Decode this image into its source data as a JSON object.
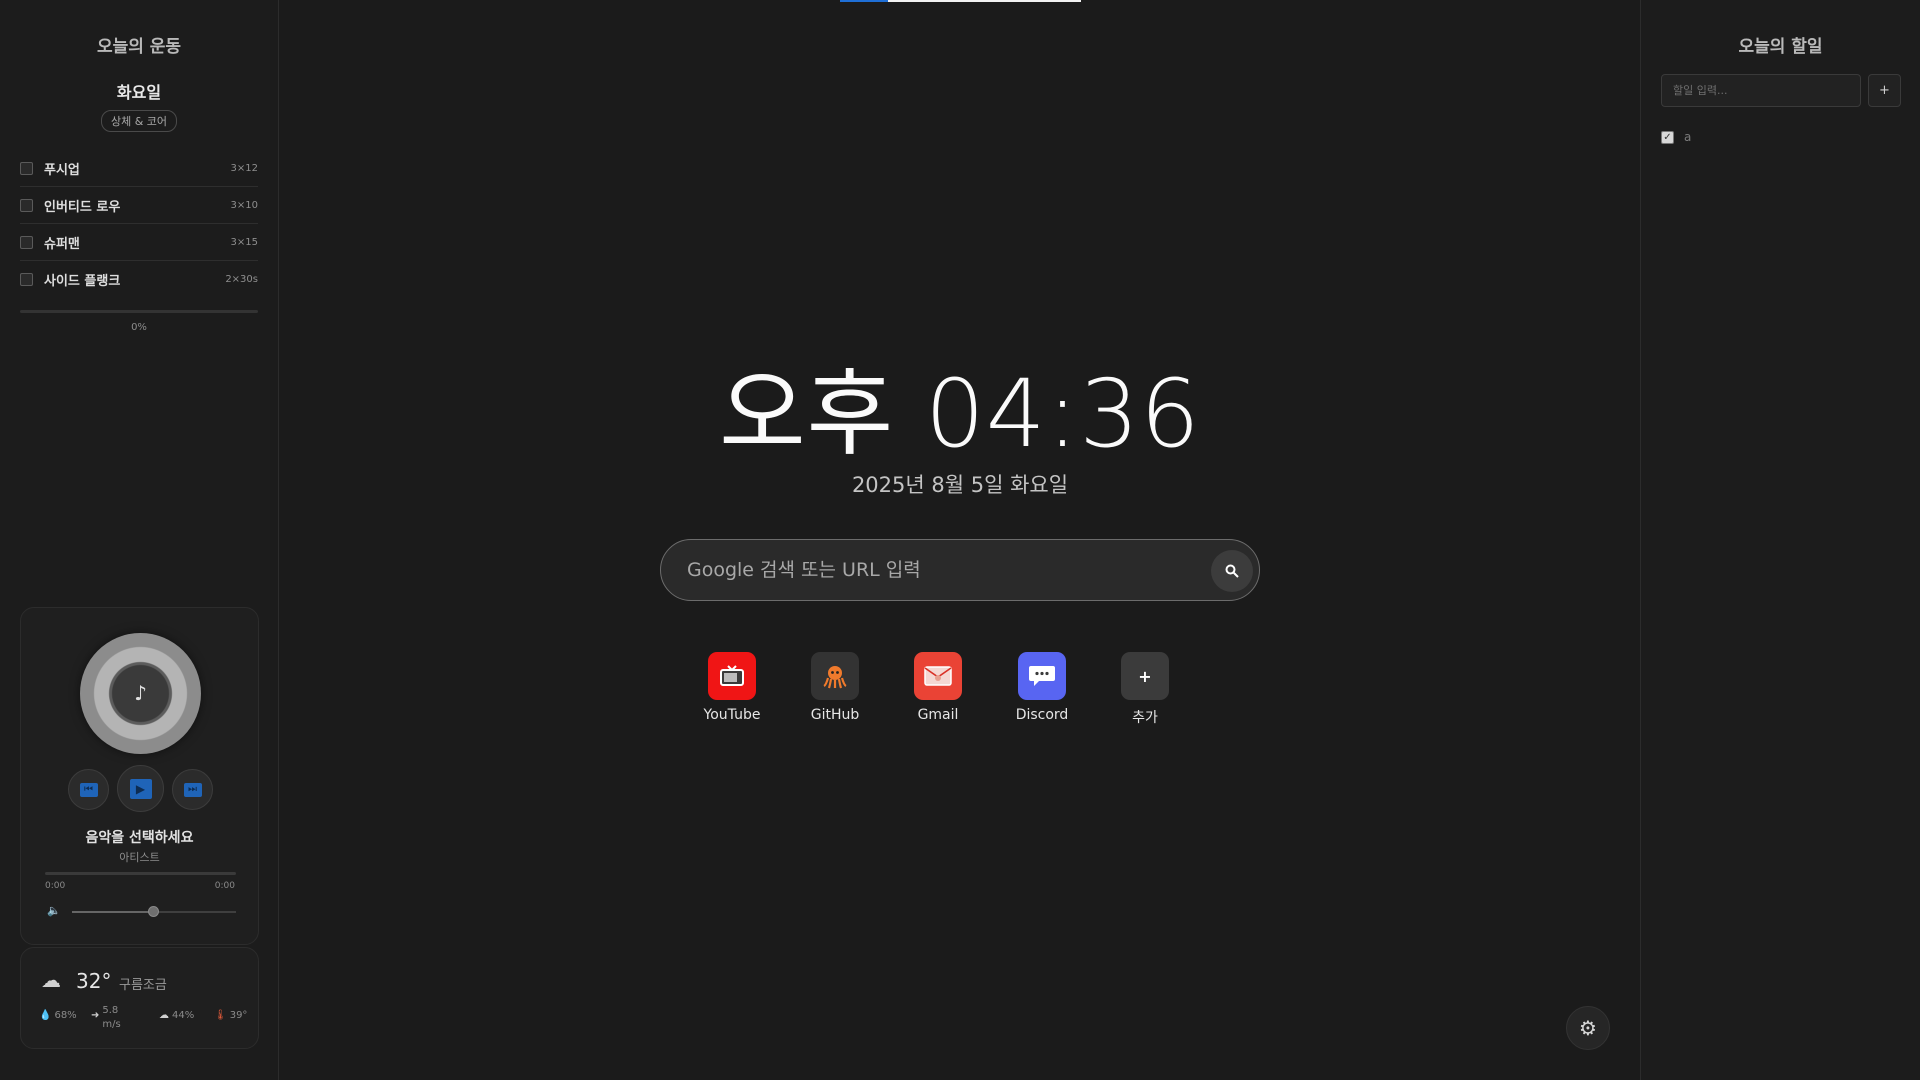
{
  "top_progress": {
    "value": 0.2
  },
  "workout": {
    "title": "오늘의 운동",
    "day": "화요일",
    "focus": "상체 & 코어",
    "exercises": [
      {
        "name": "푸시업",
        "sets": "3×12",
        "done": false
      },
      {
        "name": "인버티드 로우",
        "sets": "3×10",
        "done": false
      },
      {
        "name": "슈퍼맨",
        "sets": "3×15",
        "done": false
      },
      {
        "name": "사이드 플랭크",
        "sets": "2×30s",
        "done": false
      }
    ],
    "progress_label": "0%",
    "progress_value": 0
  },
  "music": {
    "title": "음악을 선택하세요",
    "artist": "아티스트",
    "current_time": "0:00",
    "total_time": "0:00",
    "volume": 0.5,
    "icons": {
      "disc": "music-note-icon",
      "prev": "previous-track-icon",
      "play": "play-icon",
      "next": "next-track-icon",
      "volume": "volume-icon"
    }
  },
  "weather": {
    "temp": "32°",
    "desc": "구름조금",
    "humidity": "68%",
    "wind": "5.8 m/s",
    "cloud": "44%",
    "feels_like": "39°",
    "icons": {
      "condition": "partly-cloudy-icon",
      "humidity": "droplet-icon",
      "wind": "wind-icon",
      "cloud": "cloud-icon",
      "feels_like": "thermometer-icon"
    }
  },
  "clock": {
    "time": "오후 04:36",
    "date": "2025년 8월 5일 화요일"
  },
  "search": {
    "placeholder": "Google 검색 또는 URL 입력",
    "value": ""
  },
  "shortcuts": [
    {
      "label": "YouTube",
      "icon": "tv-icon",
      "color": "#f01515"
    },
    {
      "label": "GitHub",
      "icon": "octopus-icon",
      "color": "#333333"
    },
    {
      "label": "Gmail",
      "icon": "envelope-icon",
      "color": "#ea4335"
    },
    {
      "label": "Discord",
      "icon": "chat-bubble-icon",
      "color": "#5865f2"
    },
    {
      "label": "추가",
      "icon": "plus-icon",
      "color": "#3b3b3b"
    }
  ],
  "todo": {
    "title": "오늘의 할일",
    "placeholder": "할일 입력...",
    "add_label": "+",
    "items": [
      {
        "text": "a",
        "done": true
      }
    ]
  },
  "colors": {
    "background": "#1b1b1b",
    "accent": "#1f6fd6"
  }
}
